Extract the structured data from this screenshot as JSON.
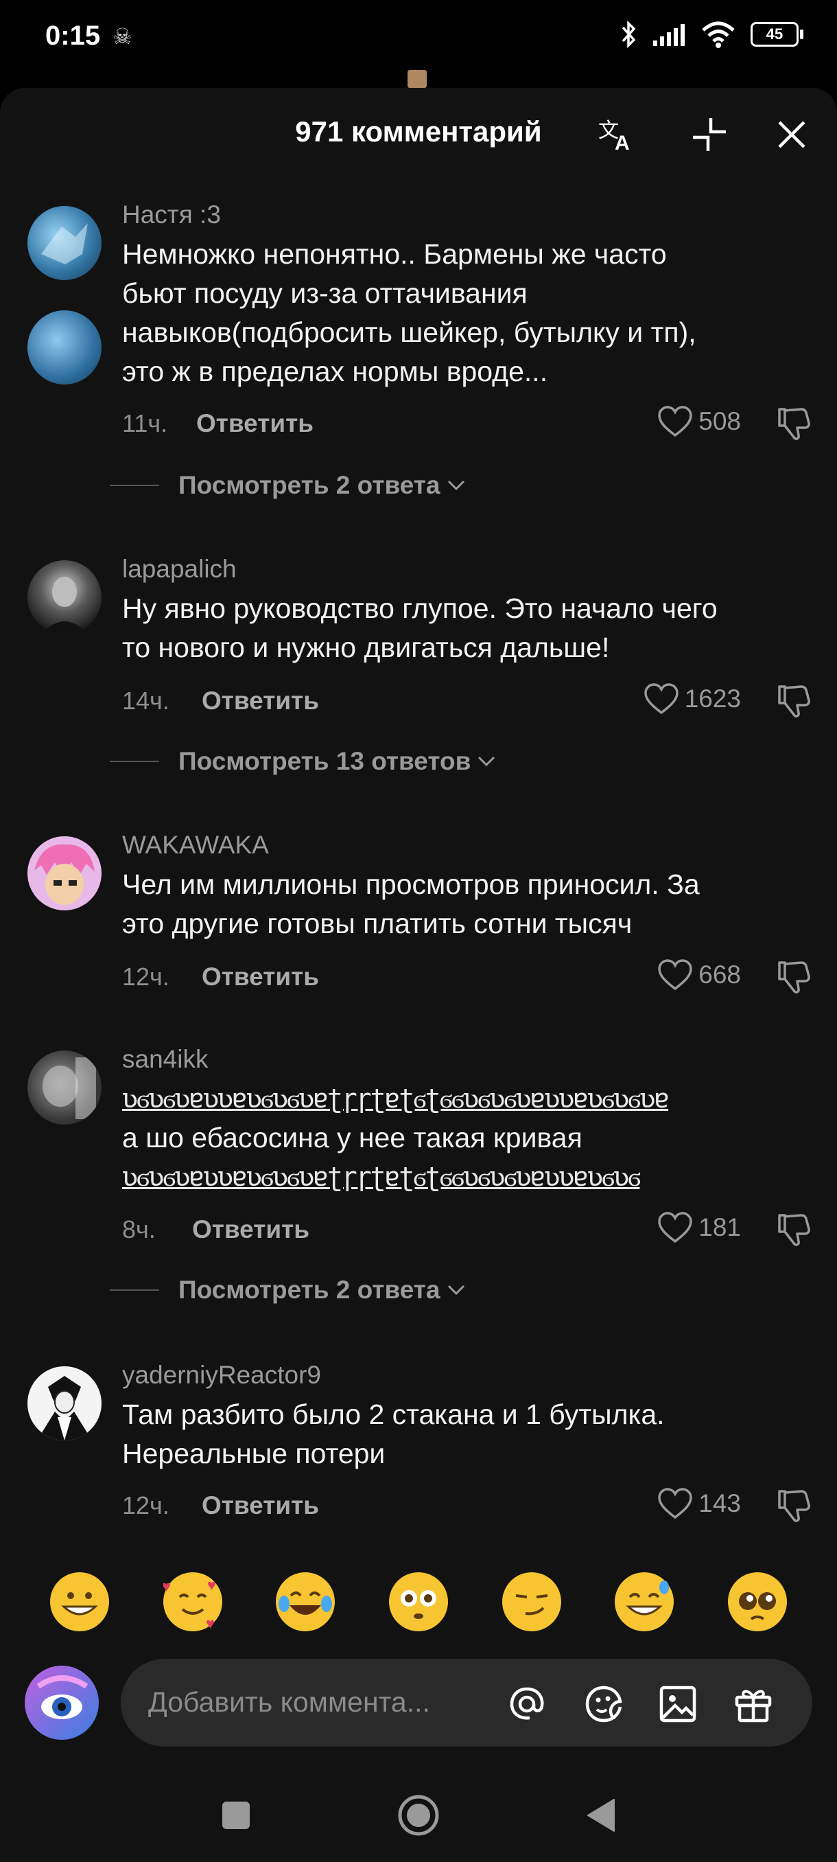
{
  "status": {
    "time": "0:15",
    "battery": "45"
  },
  "header": {
    "title": "971 комментарий"
  },
  "comments": [
    {
      "user": "Настя :3",
      "lines": [
        "Немножко непонятно.. Бармены же часто",
        "бьют посуду из-за оттачивания",
        "навыков(подбросить шейкер, бутылку и тп),",
        "это ж в пределах нормы вроде..."
      ],
      "time": "11ч.",
      "reply": "Ответить",
      "likes": "508",
      "view_replies": "Посмотреть 2 ответа"
    },
    {
      "user": "lapapalich",
      "lines": [
        "Ну явно руководство глупое. Это начало чего",
        "то нового и нужно двигаться дальше!"
      ],
      "time": "14ч.",
      "reply": "Ответить",
      "likes": "1623",
      "view_replies": "Посмотреть 13 ответов"
    },
    {
      "user": "WAKAWAKA",
      "lines": [
        "Чел им миллионы просмотров приносил. За",
        "это другие готовы платить сотни тысяч"
      ],
      "time": "12ч.",
      "reply": "Ответить",
      "likes": "668"
    },
    {
      "user": "san4ikk",
      "deco_top": "ʋϭʋϭʋɐʋʋɐʋϭʋϭʋɐʈɼɼʈɐʈϭʈϭϭʋϭʋϭʋɐʋʋɐʋϭʋϭʋɐ",
      "lines": [
        "а шо ебасосина у нее такая кривая"
      ],
      "deco_bottom": "ʋϭʋϭʋɐʋʋɐʋϭʋϭʋɐʈɼɼʈɐʈϭʈϭϭʋϭʋϭʋɐʋʋɐʋϭʋϭ",
      "time": "8ч.",
      "reply": "Ответить",
      "likes": "181",
      "view_replies": "Посмотреть 2 ответа"
    },
    {
      "user": "yaderniyReactor9",
      "lines": [
        "Там разбито было 2 стакана и 1 бутылка.",
        "Нереальные потери"
      ],
      "time": "12ч.",
      "reply": "Ответить",
      "likes": "143"
    }
  ],
  "emojis": [
    "grinning-face-icon",
    "smiling-face-with-hearts-icon",
    "tears-of-joy-icon",
    "flushed-face-icon",
    "smirking-face-icon",
    "sweat-smile-icon",
    "pleading-face-icon"
  ],
  "composer": {
    "placeholder": "Добавить коммента..."
  }
}
